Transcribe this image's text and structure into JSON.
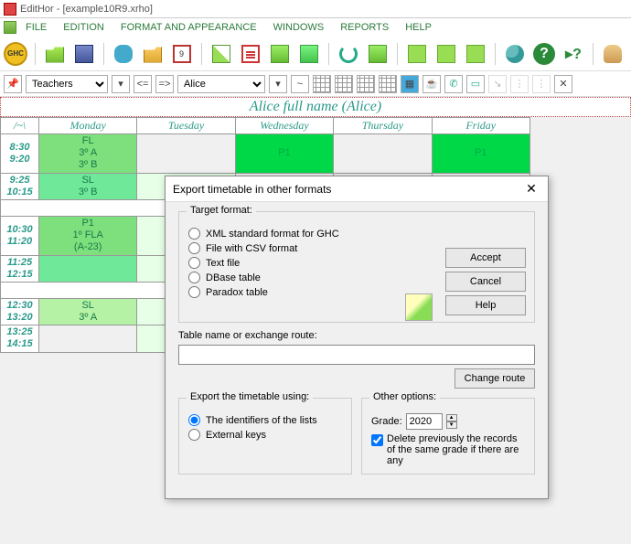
{
  "titlebar": {
    "app": "EditHor",
    "doc": "[example10R9.xrho]"
  },
  "menus": [
    "FILE",
    "EDITION",
    "FORMAT AND APPEARANCE",
    "WINDOWS",
    "REPORTS",
    "HELP"
  ],
  "selector": {
    "pin": "⌂",
    "type": "Teachers",
    "prev": "<=",
    "next": "=>",
    "name": "Alice",
    "tilde": "~"
  },
  "full_name": "Alice full name (Alice)",
  "days": [
    "Monday",
    "Tuesday",
    "Wednesday",
    "Thursday",
    "Friday"
  ],
  "corner": "/~\\",
  "times": [
    [
      "8:30",
      "9:20"
    ],
    [
      "9:25",
      "10:15"
    ],
    [
      "10:30",
      "11:20"
    ],
    [
      "11:25",
      "12:15"
    ],
    [
      "12:30",
      "13:20"
    ],
    [
      "13:25",
      "14:15"
    ]
  ],
  "cells": {
    "r0c0": [
      "FL",
      "3º A",
      "3º B"
    ],
    "r0c2": [
      "P1"
    ],
    "r0c4": [
      "P1"
    ],
    "r1c0": [
      "SL",
      "3º B"
    ],
    "r2c0": [
      "P1",
      "1º FLA",
      "(A-23)"
    ],
    "r4c0": [
      "SL",
      "3º A"
    ]
  },
  "dialog": {
    "title": "Export timetable in other formats",
    "target_legend": "Target format:",
    "options": [
      "XML standard format for GHC",
      "File with CSV format",
      "Text file",
      "DBase table",
      "Paradox table"
    ],
    "accept": "Accept",
    "cancel": "Cancel",
    "help": "Help",
    "route_label": "Table name or exchange route:",
    "route_value": "",
    "change_route": "Change route",
    "export_legend": "Export the timetable using:",
    "export_opts": [
      "The identifiers of the lists",
      "External keys"
    ],
    "other_legend": "Other options:",
    "grade_label": "Grade:",
    "grade_value": "2020",
    "delete_label": "Delete previously the records of the same grade if there are any"
  }
}
